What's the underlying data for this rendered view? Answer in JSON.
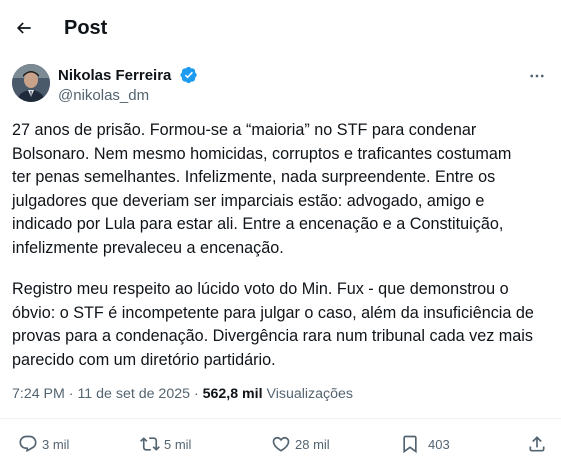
{
  "header": {
    "title": "Post"
  },
  "author": {
    "name": "Nikolas Ferreira",
    "handle": "@nikolas_dm",
    "verified_color": "#1d9bf0"
  },
  "post": {
    "paragraph1": [
      "27 anos de prisão. Formou-se a “maioria” no STF para condenar",
      "Bolsonaro. Nem mesmo homicidas, corruptos e traficantes costumam",
      "ter penas semelhantes. Infelizmente, nada surpreendente. Entre os",
      "julgadores que deveriam ser imparciais estão:  advogado, amigo e",
      "indicado por Lula para estar ali. Entre a encenação e a Constituição,",
      "infelizmente prevaleceu a encenação."
    ],
    "paragraph2": [
      "Registro meu respeito ao lúcido voto do Min. Fux - que demonstrou o",
      "óbvio: o STF é incompetente para julgar o caso, além da insuficiência de",
      "provas para a condenação. Divergência rara num tribunal cada vez mais",
      "parecido com um diretório partidário."
    ]
  },
  "meta": {
    "time": "7:24 PM",
    "separator": " · ",
    "date": "11 de set de 2025",
    "views_count": "562,8 mil",
    "views_label": "Visualizações"
  },
  "actions": {
    "replies": "3 mil",
    "reposts": "5 mil",
    "likes": "28 mil",
    "bookmarks": "403"
  },
  "icons": {
    "back": "arrow-left-icon",
    "verified": "verified-badge-icon",
    "more": "more-horizontal-icon",
    "reply": "comment-icon",
    "repost": "repost-icon",
    "like": "heart-icon",
    "bookmark": "bookmark-icon",
    "share": "share-icon"
  },
  "colors": {
    "text": "#0f1419",
    "secondary": "#536471",
    "accent": "#1d9bf0"
  }
}
